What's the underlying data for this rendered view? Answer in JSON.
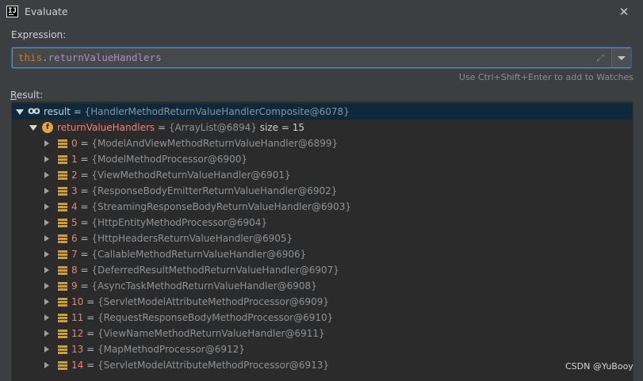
{
  "window": {
    "title": "Evaluate",
    "app_icon_text": "IJ"
  },
  "expression": {
    "label": "Expression:",
    "keyword": "this",
    "dot": ".",
    "identifier": "returnValueHandlers",
    "hint": "Use Ctrl+Shift+Enter to add to Watches"
  },
  "result": {
    "label_mnemonic": "R",
    "label_rest": "esult:",
    "root": {
      "name": "result",
      "eq": " = ",
      "value": "{HandlerMethodReturnValueHandlerComposite@6078}"
    },
    "field": {
      "name": "returnValueHandlers",
      "eq": " = ",
      "value": "{ArrayList@6894}",
      "size": "  size = 15"
    },
    "items": [
      {
        "index": "0",
        "value": "{ModelAndViewMethodReturnValueHandler@6899}"
      },
      {
        "index": "1",
        "value": "{ModelMethodProcessor@6900}"
      },
      {
        "index": "2",
        "value": "{ViewMethodReturnValueHandler@6901}"
      },
      {
        "index": "3",
        "value": "{ResponseBodyEmitterReturnValueHandler@6902}"
      },
      {
        "index": "4",
        "value": "{StreamingResponseBodyReturnValueHandler@6903}"
      },
      {
        "index": "5",
        "value": "{HttpEntityMethodProcessor@6904}"
      },
      {
        "index": "6",
        "value": "{HttpHeadersReturnValueHandler@6905}"
      },
      {
        "index": "7",
        "value": "{CallableMethodReturnValueHandler@6906}"
      },
      {
        "index": "8",
        "value": "{DeferredResultMethodReturnValueHandler@6907}"
      },
      {
        "index": "9",
        "value": "{AsyncTaskMethodReturnValueHandler@6908}"
      },
      {
        "index": "10",
        "value": "{ServletModelAttributeMethodProcessor@6909}"
      },
      {
        "index": "11",
        "value": "{RequestResponseBodyMethodProcessor@6910}"
      },
      {
        "index": "12",
        "value": "{ViewNameMethodReturnValueHandler@6911}"
      },
      {
        "index": "13",
        "value": "{MapMethodProcessor@6912}"
      },
      {
        "index": "14",
        "value": "{ServletModelAttributeMethodProcessor@6913}"
      }
    ]
  },
  "watermark": "CSDN @YuBooy",
  "colors": {
    "background": "#3c3f41",
    "tree_background": "#2b2b2b",
    "selection": "#0d293e",
    "keyword": "#cc7832",
    "field_name": "#f0807a",
    "value": "#8f9396",
    "field_icon": "#e3a24d"
  },
  "icons": {
    "close": "close-icon",
    "expand": "expand-icon",
    "dropdown": "dropdown-arrow-icon",
    "watch": "watch-glasses-icon",
    "field": "field-f-icon",
    "element": "list-element-icon"
  }
}
